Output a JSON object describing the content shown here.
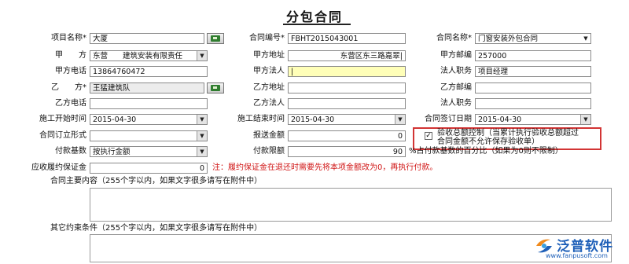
{
  "title": "分包合同",
  "fields": {
    "project_name": {
      "label": "项目名称*",
      "value": "大厦"
    },
    "contract_no": {
      "label": "合同编号*",
      "value": "FBHT2015043001"
    },
    "contract_name": {
      "label": "合同名称*",
      "value": "门窗安装外包合同"
    },
    "party_a": {
      "label": "甲　　方",
      "value": "东营　　建筑安装有限责任"
    },
    "party_a_address": {
      "label": "甲方地址",
      "value": "东营区东三路嘉翠|"
    },
    "party_a_postcode": {
      "label": "甲方邮编",
      "value": "257000"
    },
    "party_a_phone": {
      "label": "甲方电话",
      "value": "13864760472"
    },
    "party_a_legal": {
      "label": "甲方法人",
      "value": "|"
    },
    "legal_position": {
      "label": "法人职务",
      "value": "项目经理"
    },
    "party_b": {
      "label": "乙　　方*",
      "value": "王猛建筑队"
    },
    "party_b_address": {
      "label": "乙方地址",
      "value": ""
    },
    "party_b_postcode": {
      "label": "乙方邮编",
      "value": ""
    },
    "party_b_phone": {
      "label": "乙方电话",
      "value": ""
    },
    "party_b_legal": {
      "label": "乙方法人",
      "value": ""
    },
    "party_b_legal_position": {
      "label": "法人职务",
      "value": ""
    },
    "start_time": {
      "label": "施工开始时间",
      "value": "2015-04-30"
    },
    "end_time": {
      "label": "施工结束时间",
      "value": "2015-04-30"
    },
    "sign_date": {
      "label": "合同签订日期",
      "value": "2015-04-30"
    },
    "contract_form": {
      "label": "合同订立形式",
      "value": ""
    },
    "report_amount": {
      "label": "报送金额",
      "value": "0"
    },
    "pay_base": {
      "label": "付款基数",
      "value": "按执行金额"
    },
    "pay_limit": {
      "label": "付款限额",
      "value": "90"
    },
    "pay_limit_note": "%占付款基数的百分比（如果为0则不限制）",
    "deposit": {
      "label": "应收履约保证金",
      "value": "0"
    },
    "deposit_note": "注：履约保证金在退还时需要先将本项金额改为0，再执行付款。"
  },
  "acceptance_check": {
    "checked": true,
    "line1": "验收总额控制（当累计执行验收总额超过",
    "line2": "合同金额不允许保存验收单）"
  },
  "main_content_label": "合同主要内容（255个字以内，如果文字很多请写在附件中）",
  "other_terms_label": "其它约束条件（255个字以内，如果文字很多请写在附件中）",
  "brand": {
    "name": "泛普软件",
    "url": "www.fanpusoft.com",
    "color": "#1e5fb8"
  },
  "icons": {
    "dropdown": "▼"
  }
}
